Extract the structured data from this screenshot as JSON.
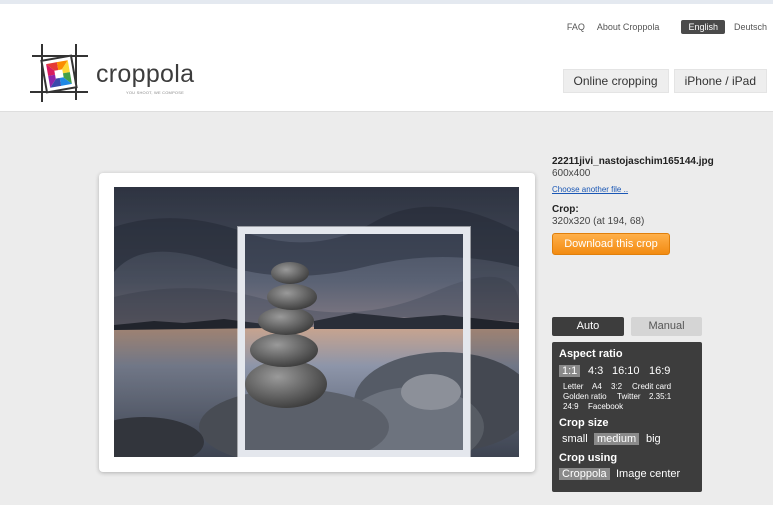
{
  "header": {
    "links": [
      "FAQ",
      "About Croppola"
    ],
    "languages": [
      "English",
      "Deutsch"
    ],
    "active_language": "English",
    "logo_text": "croppola",
    "logo_tagline": "YOU SHOOT, WE COMPOSE",
    "nav": [
      "Online cropping",
      "iPhone / iPad"
    ]
  },
  "image": {
    "filename": "22211jivi_nastojaschim165144.jpg",
    "size": "600x400",
    "choose_link": "Choose another file ..",
    "crop_label": "Crop:",
    "crop_value": "320x320 (at 194, 68)",
    "download_label": "Download this crop"
  },
  "mode": {
    "auto": "Auto",
    "manual": "Manual",
    "active": "Auto"
  },
  "panel": {
    "aspect_title": "Aspect ratio",
    "aspect_main": [
      "1:1",
      "4:3",
      "16:10",
      "16:9"
    ],
    "aspect_selected": "1:1",
    "aspect_row2": [
      "Letter",
      "A4",
      "3:2",
      "Credit card"
    ],
    "aspect_row3": [
      "Golden ratio",
      "Twitter",
      "2.35:1"
    ],
    "aspect_row4": [
      "24:9",
      "Facebook"
    ],
    "size_title": "Crop size",
    "sizes": [
      "small",
      "medium",
      "big"
    ],
    "size_selected": "medium",
    "using_title": "Crop using",
    "using": [
      "Croppola",
      "Image center"
    ],
    "using_selected": "Croppola"
  },
  "colors": {
    "accent_orange": "#f28b12",
    "panel_dark": "#3d3d3d",
    "link_blue": "#1a57b5"
  }
}
